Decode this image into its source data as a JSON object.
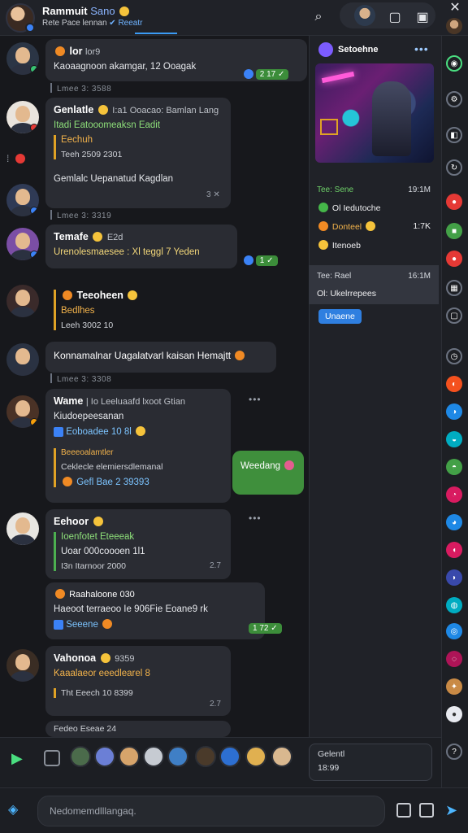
{
  "header": {
    "title": "Rammuit",
    "title_accent": "Sano",
    "subtitle": "Rete Pace lennan",
    "subtitle_tag": "✔ Reeatr",
    "icons": [
      "search-icon",
      "folder-icon",
      "picture-icon",
      "close-icon"
    ]
  },
  "messages": [
    {
      "sender": "lor",
      "meta": "lor9",
      "line1": "Kaoaagnoon akamgar, 12 Ooagak",
      "time": "2 17 ✓",
      "divider": "Lmee 3: 3588"
    },
    {
      "sender": "Genlatle",
      "meta": "I:a1 Ooacao: Bamlan Lang",
      "line1": "Itadi  Eatooomeaksn  Eadit",
      "quote": "Eechuh",
      "quote2": "Teeh 2509 2301",
      "line3": "Gemlalc Uepanatud Kagdlan",
      "time": "3 ✕",
      "divider": "Lmee 3: 3319"
    },
    {
      "sender": "Temafe",
      "meta": "E2d",
      "line1": "Urenolesmaesee : Xl teggl 7 Yeden",
      "time": "1 ✓"
    },
    {
      "sender": "Teeoheen",
      "quote_name": "Bedlhes",
      "quote_line": "Leeh 3002 10",
      "time": ""
    },
    {
      "sender": "Konnamalnar Uagalatvarl kaisan Hemajtt",
      "divider": "Lmee 3: 3308"
    },
    {
      "sender": "Wame",
      "meta": "| Io Leeluaafd lxoot Gtian",
      "line1": "Kiudoepeesanan",
      "link": "Eoboadee 10 8l",
      "quote_name": "Beeeoalamtler",
      "quote_line": "Ceklecle elemiersdlemanal",
      "badge": "Gefl Bae 2 39393",
      "out_text": "Weedang"
    },
    {
      "sender": "Eehoor",
      "quote_name": "Ioenfotet Eteeeak",
      "quote_line": "Uoar 000coooen 1l1",
      "line3": "I3n  Itarnoor 2000",
      "time": "2.7"
    },
    {
      "sender": "Raahaloone 030",
      "line1": "Haeoot terraeoo Ie 906Fie Eoane9 rk",
      "chip": "Seeene",
      "time": "1 72 ✓"
    },
    {
      "sender": "Vahonoa",
      "meta": "9359",
      "line1": "Kaaalaeor eeedlearel 8",
      "line3": "Tht  Eeech  10 8399",
      "time": "2.7",
      "tail": "Fedeo Eseae 24"
    }
  ],
  "panel": {
    "title": "Setoehne",
    "items": [
      {
        "name": "Tee: Sene",
        "time": "19:1M",
        "line2": "Ol Iedutoche",
        "line3a": "Donteel",
        "line3b": "1:7K",
        "line4": "Itenoeb"
      },
      {
        "name": "Tee: Rael",
        "time": "16:1M",
        "line2": "Ol: Ukelrrepees",
        "active": true
      }
    ],
    "button": "Unaene"
  },
  "mini_card": {
    "line1": "Gelentl",
    "line2": "18:99"
  },
  "composer": {
    "placeholder": "Nedomemdlllangaq."
  },
  "colors": {
    "accent": "#3b82f6",
    "outgoing": "#3f8f3c",
    "panel": "#202228",
    "background": "#17181c"
  }
}
